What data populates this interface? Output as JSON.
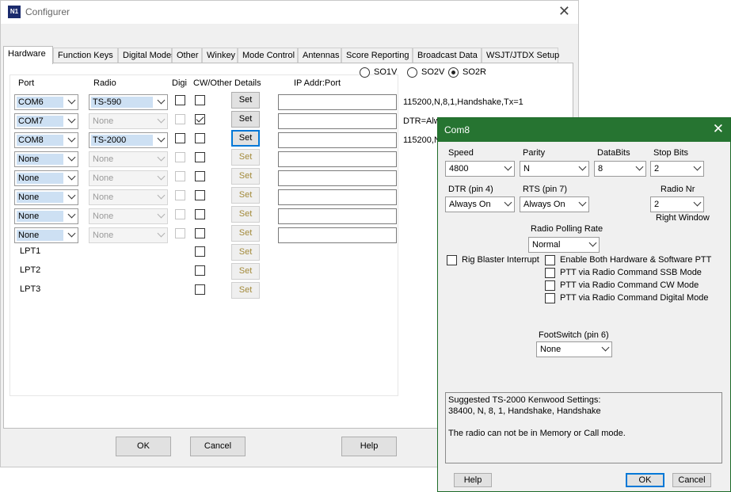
{
  "configurer": {
    "title": "Configurer",
    "tabs": [
      "Hardware",
      "Function Keys",
      "Digital Modes",
      "Other",
      "Winkey",
      "Mode Control",
      "Antennas",
      "Score Reporting",
      "Broadcast Data",
      "WSJT/JTDX Setup"
    ],
    "active_tab": "Hardware",
    "so_options": [
      "SO1V",
      "SO2V",
      "SO2R"
    ],
    "so_selected": "SO2R",
    "headers": {
      "port": "Port",
      "radio": "Radio",
      "digi": "Digi",
      "cw_other": "CW/Other",
      "details": "Details",
      "ip": "IP Addr:Port"
    },
    "rows": [
      {
        "port": "COM6",
        "radio": "TS-590",
        "radio_enabled": true,
        "digi": false,
        "cw": false,
        "set": "Set",
        "set_enabled": true,
        "info": "115200,N,8,1,Handshake,Tx=1"
      },
      {
        "port": "COM7",
        "radio": "None",
        "radio_enabled": false,
        "digi": false,
        "cw": true,
        "set": "Set",
        "set_enabled": true,
        "info": "DTR=Alw"
      },
      {
        "port": "COM8",
        "radio": "TS-2000",
        "radio_enabled": true,
        "digi": false,
        "cw": false,
        "set": "Set",
        "set_enabled": true,
        "focused": true,
        "info": "115200,N"
      },
      {
        "port": "None",
        "radio": "None",
        "radio_enabled": false,
        "digi": false,
        "cw": false,
        "set": "Set",
        "set_enabled": false,
        "info": ""
      },
      {
        "port": "None",
        "radio": "None",
        "radio_enabled": false,
        "digi": false,
        "cw": false,
        "set": "Set",
        "set_enabled": false,
        "info": ""
      },
      {
        "port": "None",
        "radio": "None",
        "radio_enabled": false,
        "digi": false,
        "cw": false,
        "set": "Set",
        "set_enabled": false,
        "info": ""
      },
      {
        "port": "None",
        "radio": "None",
        "radio_enabled": false,
        "digi": false,
        "cw": false,
        "set": "Set",
        "set_enabled": false,
        "info": ""
      },
      {
        "port": "None",
        "radio": "None",
        "radio_enabled": false,
        "digi": false,
        "cw": false,
        "set": "Set",
        "set_enabled": false,
        "info": ""
      }
    ],
    "lpt_rows": [
      {
        "label": "LPT1",
        "set": "Set"
      },
      {
        "label": "LPT2",
        "set": "Set"
      },
      {
        "label": "LPT3",
        "set": "Set"
      }
    ],
    "buttons": {
      "ok": "OK",
      "cancel": "Cancel",
      "help": "Help"
    }
  },
  "com_dialog": {
    "title": "Com8",
    "speed": {
      "label": "Speed",
      "value": "4800"
    },
    "parity": {
      "label": "Parity",
      "value": "N"
    },
    "databits": {
      "label": "DataBits",
      "value": "8"
    },
    "stopbits": {
      "label": "Stop Bits",
      "value": "2"
    },
    "dtr": {
      "label": "DTR (pin 4)",
      "value": "Always On"
    },
    "rts": {
      "label": "RTS (pin 7)",
      "value": "Always On"
    },
    "radio_nr": {
      "label": "Radio Nr",
      "value": "2",
      "note": "Right Window"
    },
    "polling": {
      "label": "Radio Polling Rate",
      "value": "Normal"
    },
    "rig_blaster": "Rig Blaster Interrupt",
    "ptt_options": [
      "Enable Both Hardware & Software PTT",
      "PTT via Radio Command SSB Mode",
      "PTT via Radio Command CW Mode",
      "PTT via Radio Command Digital Mode"
    ],
    "footswitch": {
      "label": "FootSwitch (pin 6)",
      "value": "None"
    },
    "memo_lines": [
      "Suggested TS-2000 Kenwood Settings:",
      "38400, N, 8, 1, Handshake, Handshake",
      "",
      "The radio can not be in Memory or Call mode."
    ],
    "buttons": {
      "help": "Help",
      "ok": "OK",
      "cancel": "Cancel"
    }
  }
}
